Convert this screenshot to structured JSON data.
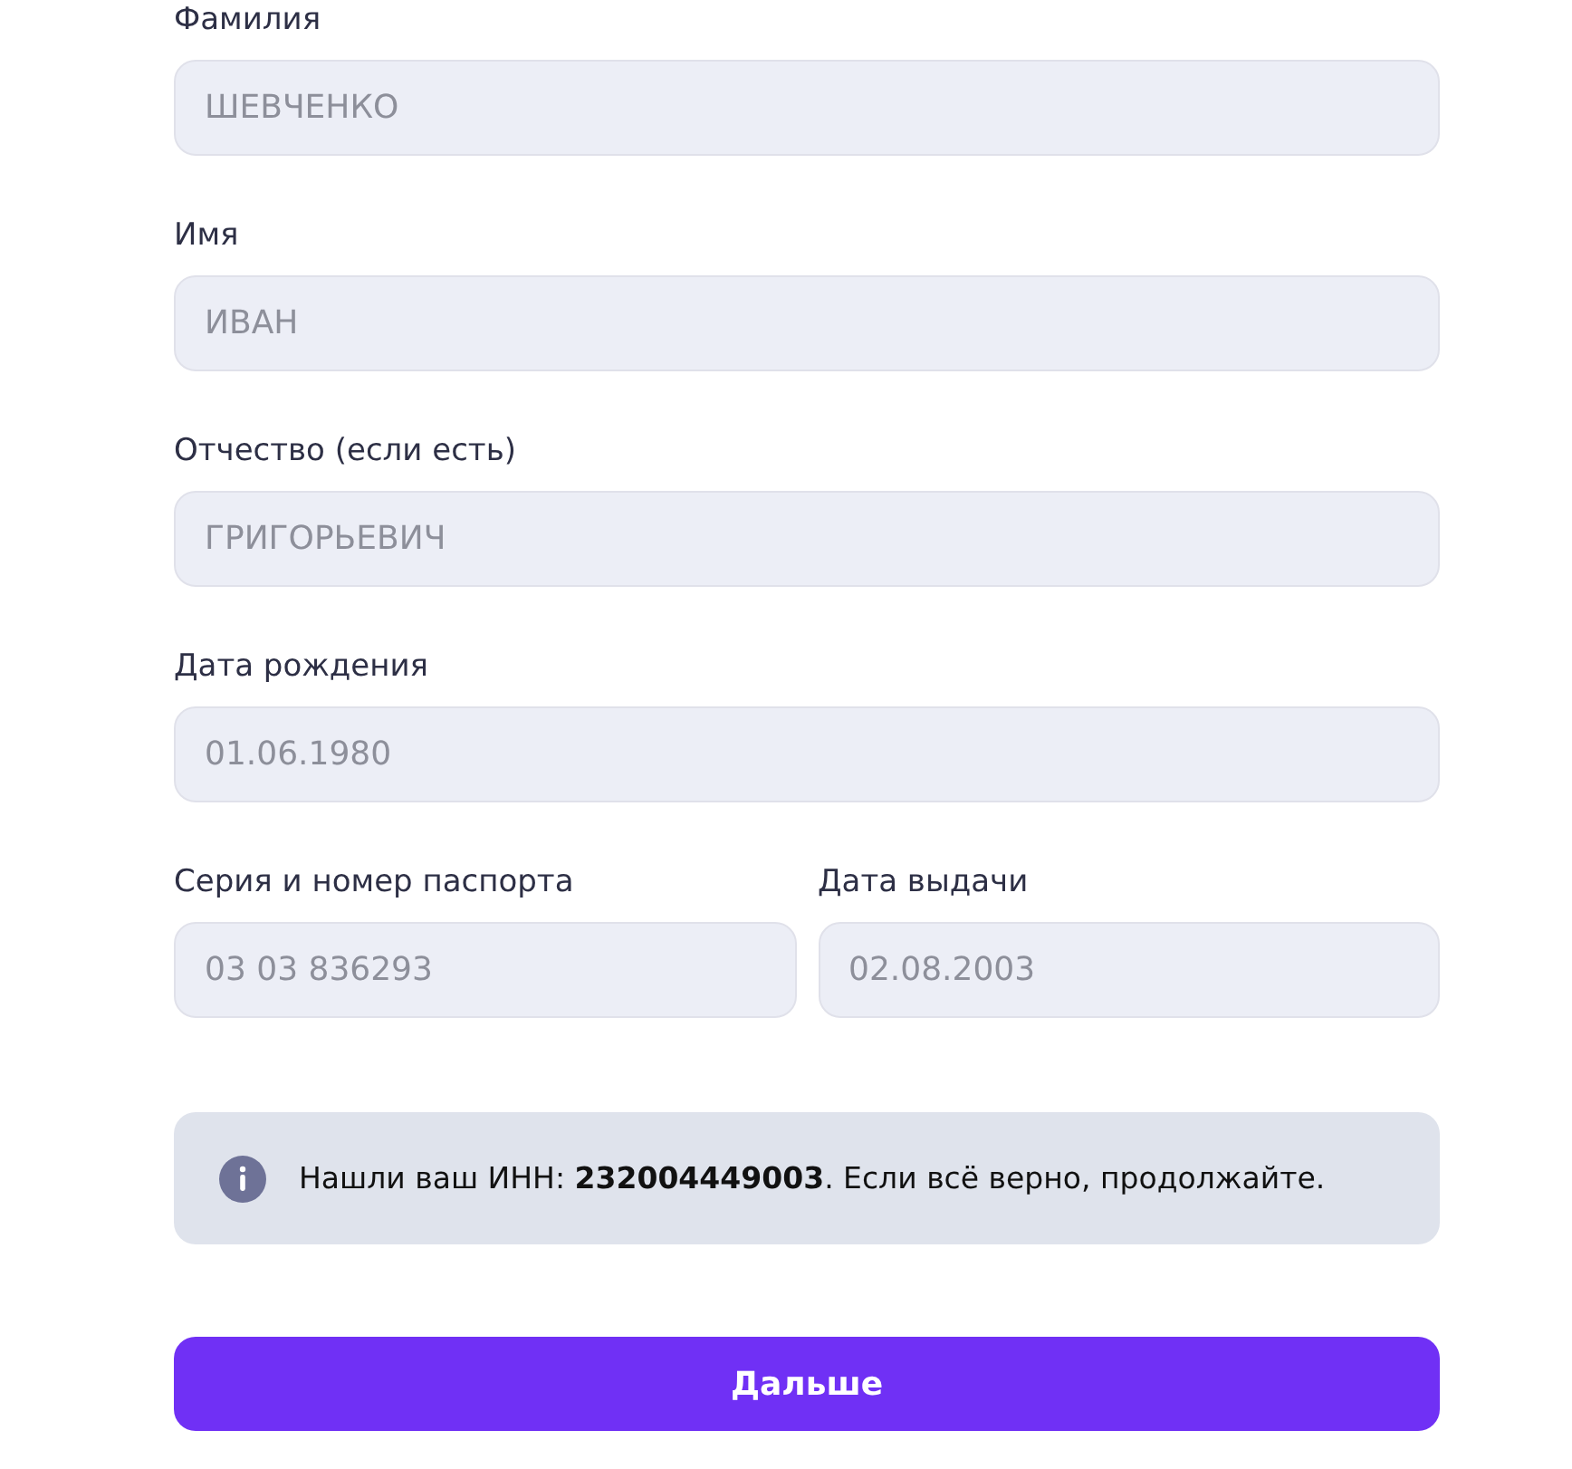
{
  "form_rows": [
    {
      "fields": [
        {
          "label": "Фамилия",
          "value": "ШЕВЧЕНКО",
          "disabled": true
        }
      ]
    },
    {
      "fields": [
        {
          "label": "Имя",
          "value": "ИВАН",
          "disabled": true
        }
      ]
    },
    {
      "fields": [
        {
          "label": "Отчество (если есть)",
          "value": "ГРИГОРЬЕВИЧ",
          "disabled": true
        }
      ]
    },
    {
      "fields": [
        {
          "label": "Дата рождения",
          "value": "01.06.1980",
          "disabled": true
        }
      ]
    },
    {
      "fields": [
        {
          "label": "Серия и номер паспорта",
          "value": "03 03 836293",
          "disabled": true
        },
        {
          "label": "Дата выдачи",
          "value": "02.08.2003",
          "disabled": true
        }
      ]
    }
  ],
  "notice": {
    "text": "Нашли ваш ИНН: **232004449003**. Если всё верно, продолжайте."
  },
  "next_button": {
    "label": "Дальше"
  }
}
